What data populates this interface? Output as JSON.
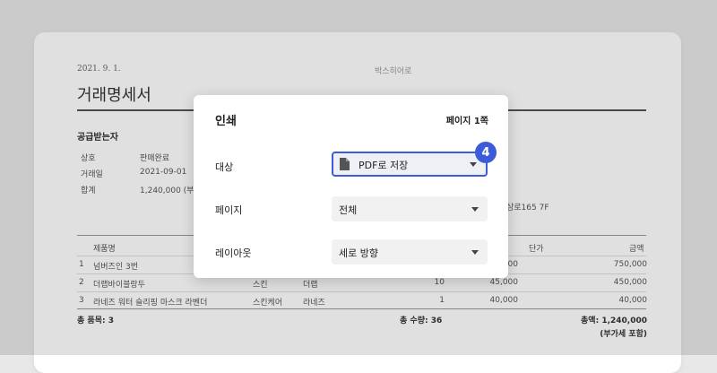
{
  "document": {
    "date": "2021. 9. 1.",
    "company": "박스히어로",
    "title": "거래명세서",
    "section_title": "공급받는자",
    "info": [
      {
        "label": "상호",
        "value": "판매완료"
      },
      {
        "label": "거래일",
        "value": "2021-09-01"
      },
      {
        "label": "합계",
        "value": "1,240,000 (부가"
      }
    ],
    "address_fragment": "삼로165 7F",
    "table_headers": {
      "name": "제품명",
      "unit_price": "단가",
      "amount": "금액"
    },
    "rows": [
      {
        "no": "1",
        "name": "넘버즈인 3번",
        "category": "",
        "brand": "",
        "qty": "",
        "price": "30,000",
        "amount": "750,000"
      },
      {
        "no": "2",
        "name": "더랩바이블랑두",
        "category": "스킨",
        "brand": "더랩",
        "qty": "10",
        "price": "45,000",
        "amount": "450,000"
      },
      {
        "no": "3",
        "name": "라네즈 워터 슬리핑 마스크 라벤더",
        "category": "스킨케어",
        "brand": "라네즈",
        "qty": "1",
        "price": "40,000",
        "amount": "40,000"
      }
    ],
    "footer": {
      "total_items": "총 품목: 3",
      "total_qty": "총 수량: 36",
      "total_amount": "총액: 1,240,000",
      "vat_note": "(부가세 포함)"
    }
  },
  "print_dialog": {
    "title": "인쇄",
    "page_count": "페이지 1쪽",
    "destination": {
      "label": "대상",
      "value": "PDF로 저장"
    },
    "pages": {
      "label": "페이지",
      "value": "전체"
    },
    "layout": {
      "label": "레이아웃",
      "value": "세로 방향"
    }
  },
  "step_badge": "4",
  "colors": {
    "accent": "#3d5bd9"
  }
}
